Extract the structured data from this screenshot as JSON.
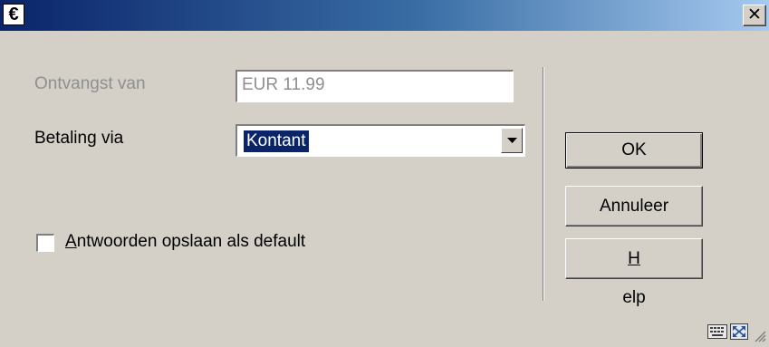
{
  "window": {
    "icon_glyph": "€",
    "close_glyph": "✕"
  },
  "form": {
    "received_label": "Ontvangst van",
    "received_value": "EUR 11.99",
    "payment_label": "Betaling via",
    "payment_selected": "Kontant",
    "checkbox_label_first": "A",
    "checkbox_label_rest": "ntwoorden opslaan als default",
    "checkbox_checked": false
  },
  "buttons": {
    "ok": "OK",
    "cancel": "Annuleer",
    "help_first": "H",
    "help_rest": "elp"
  },
  "status_icons": [
    "keyboard-icon",
    "fullscreen-icon"
  ]
}
